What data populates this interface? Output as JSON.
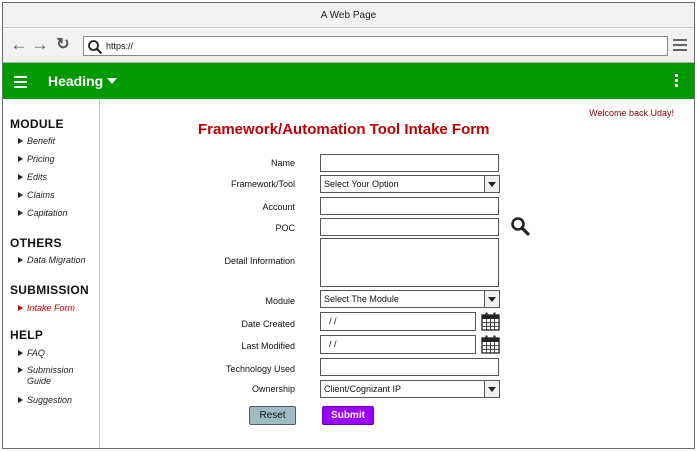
{
  "window": {
    "title": "A Web Page"
  },
  "browser": {
    "url": "https://"
  },
  "header": {
    "heading": "Heading"
  },
  "sidebar": {
    "sections": [
      {
        "title": "MODULE",
        "items": [
          "Benefit",
          "Pricing",
          "Edits",
          "Claims",
          "Capitation"
        ]
      },
      {
        "title": "OTHERS",
        "items": [
          "Data Migration"
        ]
      },
      {
        "title": "SUBMISSION",
        "items": [
          "Intake Form"
        ]
      },
      {
        "title": "HELP",
        "items": [
          "FAQ",
          "Submission Guide",
          "Suggestion"
        ]
      }
    ],
    "active_item": "Intake Form"
  },
  "main": {
    "welcome": "Welcome back Uday!",
    "form_title": "Framework/Automation Tool Intake Form",
    "labels": {
      "name": "Name",
      "framework": "Framework/Tool",
      "account": "Account",
      "poc": "POC",
      "detail": "Detail Information",
      "module": "Module",
      "date_created": "Date Created",
      "last_modified": "Last Modified",
      "technology": "Technology Used",
      "ownership": "Ownership"
    },
    "values": {
      "name": "",
      "framework": "Select Your Option",
      "account": "",
      "poc": "",
      "detail": "",
      "module": "Select The Module",
      "date_created": "/  /",
      "last_modified": "/  /",
      "technology": "",
      "ownership": "Client/Cognizant IP"
    },
    "buttons": {
      "reset": "Reset",
      "submit": "Submit"
    }
  },
  "colors": {
    "header_green": "#009a00",
    "title_red": "#c00000",
    "active_red": "#cc0000",
    "submit_purple": "#9900ff",
    "reset_blue": "#9fbcc4"
  }
}
